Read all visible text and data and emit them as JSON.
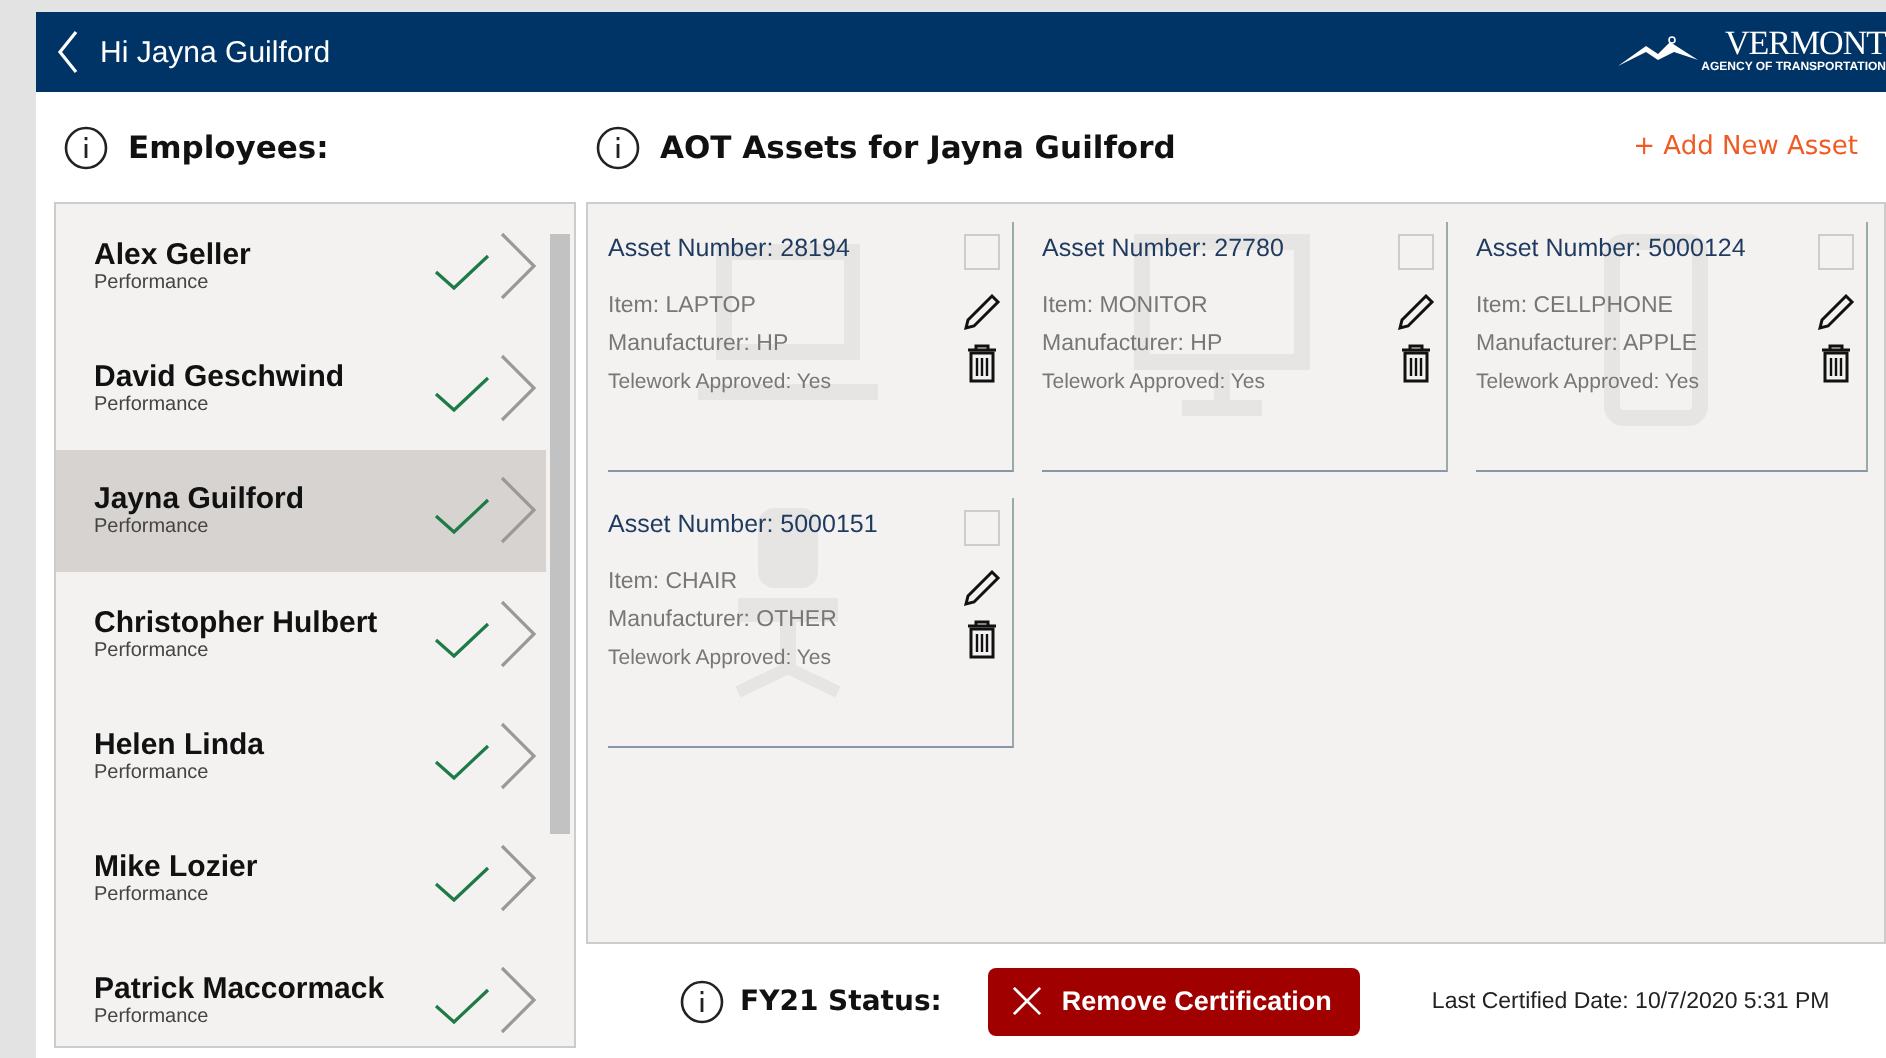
{
  "header": {
    "title": "Hi Jayna Guilford",
    "logo_text": "VERMONT",
    "logo_subtext": "AGENCY OF TRANSPORTATION"
  },
  "employees": {
    "title": "Employees:",
    "items": [
      {
        "name": "Alex Geller",
        "department": "Performance",
        "certified": true,
        "selected": false
      },
      {
        "name": "David Geschwind",
        "department": "Performance",
        "certified": true,
        "selected": false
      },
      {
        "name": "Jayna Guilford",
        "department": "Performance",
        "certified": true,
        "selected": true
      },
      {
        "name": "Christopher Hulbert",
        "department": "Performance",
        "certified": true,
        "selected": false
      },
      {
        "name": "Helen Linda",
        "department": "Performance",
        "certified": true,
        "selected": false
      },
      {
        "name": "Mike Lozier",
        "department": "Performance",
        "certified": true,
        "selected": false
      },
      {
        "name": "Patrick Maccormack",
        "department": "Performance",
        "certified": true,
        "selected": false
      }
    ]
  },
  "assets": {
    "title": "AOT Assets for Jayna Guilford",
    "add_button": "+ Add New Asset",
    "items": [
      {
        "kind": "laptop",
        "number": "Asset Number: 28194",
        "item": "Item: LAPTOP",
        "manufacturer": "Manufacturer: HP",
        "telework": "Telework Approved: Yes",
        "checked": false
      },
      {
        "kind": "monitor",
        "number": "Asset Number: 27780",
        "item": "Item: MONITOR",
        "manufacturer": "Manufacturer: HP",
        "telework": "Telework Approved: Yes",
        "checked": false
      },
      {
        "kind": "phone",
        "number": "Asset Number: 5000124",
        "item": "Item: CELLPHONE",
        "manufacturer": "Manufacturer: APPLE",
        "telework": "Telework Approved: Yes",
        "checked": false
      },
      {
        "kind": "chair",
        "number": "Asset Number: 5000151",
        "item": "Item: CHAIR",
        "manufacturer": "Manufacturer: OTHER",
        "telework": "Telework Approved: Yes",
        "checked": false
      }
    ]
  },
  "status": {
    "label": "FY21 Status:",
    "button": "Remove Certification",
    "last_certified": "Last Certified Date: 10/7/2020 5:31 PM"
  }
}
